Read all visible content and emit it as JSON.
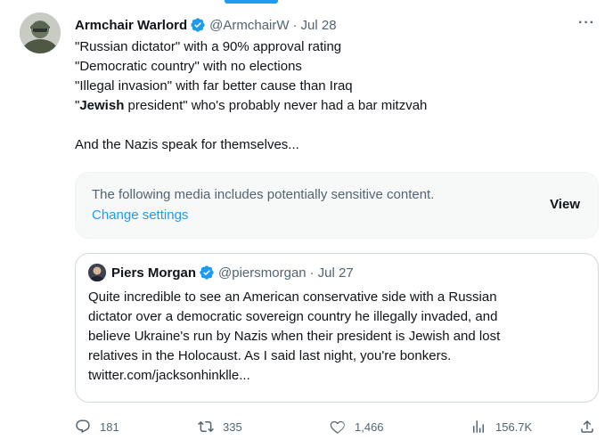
{
  "tweet": {
    "author": {
      "display_name": "Armchair Warlord",
      "handle": "@ArmchairW",
      "separator": "·",
      "date": "Jul 28",
      "verified": true
    },
    "more_label": "···",
    "lines": [
      "\"Russian dictator\" with a 90% approval rating",
      "\"Democratic country\" with no elections",
      "\"Illegal invasion\" with far better cause than Iraq"
    ],
    "line4": {
      "open": "\"",
      "bold": "Jewish",
      "rest": " president\" who's probably never had a bar mitzvah"
    },
    "closing": "And the Nazis speak for themselves...",
    "sensitive": {
      "message": "The following media includes potentially sensitive content.",
      "link": "Change settings",
      "view": "View"
    },
    "quote": {
      "display_name": "Piers Morgan",
      "handle": "@piersmorgan",
      "separator": "·",
      "date": "Jul 27",
      "lines": [
        "Quite incredible to see an American conservative side with a Russian",
        "dictator over a democratic sovereign country he illegally invaded, and",
        "believe Ukraine's run by Nazis when their president is Jewish and lost",
        "relatives in the Holocaust. As I said last night, you're bonkers.",
        "twitter.com/jacksonhinklle..."
      ]
    },
    "actions": {
      "replies": "181",
      "retweets": "335",
      "likes": "1,466",
      "views": "156.7K"
    }
  },
  "colors": {
    "accent": "#1d9bf0",
    "text": "#0f1419",
    "muted": "#536471",
    "border": "#cfd9de"
  },
  "icons": [
    "verified-badge-icon",
    "more-icon",
    "reply-icon",
    "retweet-icon",
    "like-icon",
    "views-icon",
    "share-icon"
  ]
}
